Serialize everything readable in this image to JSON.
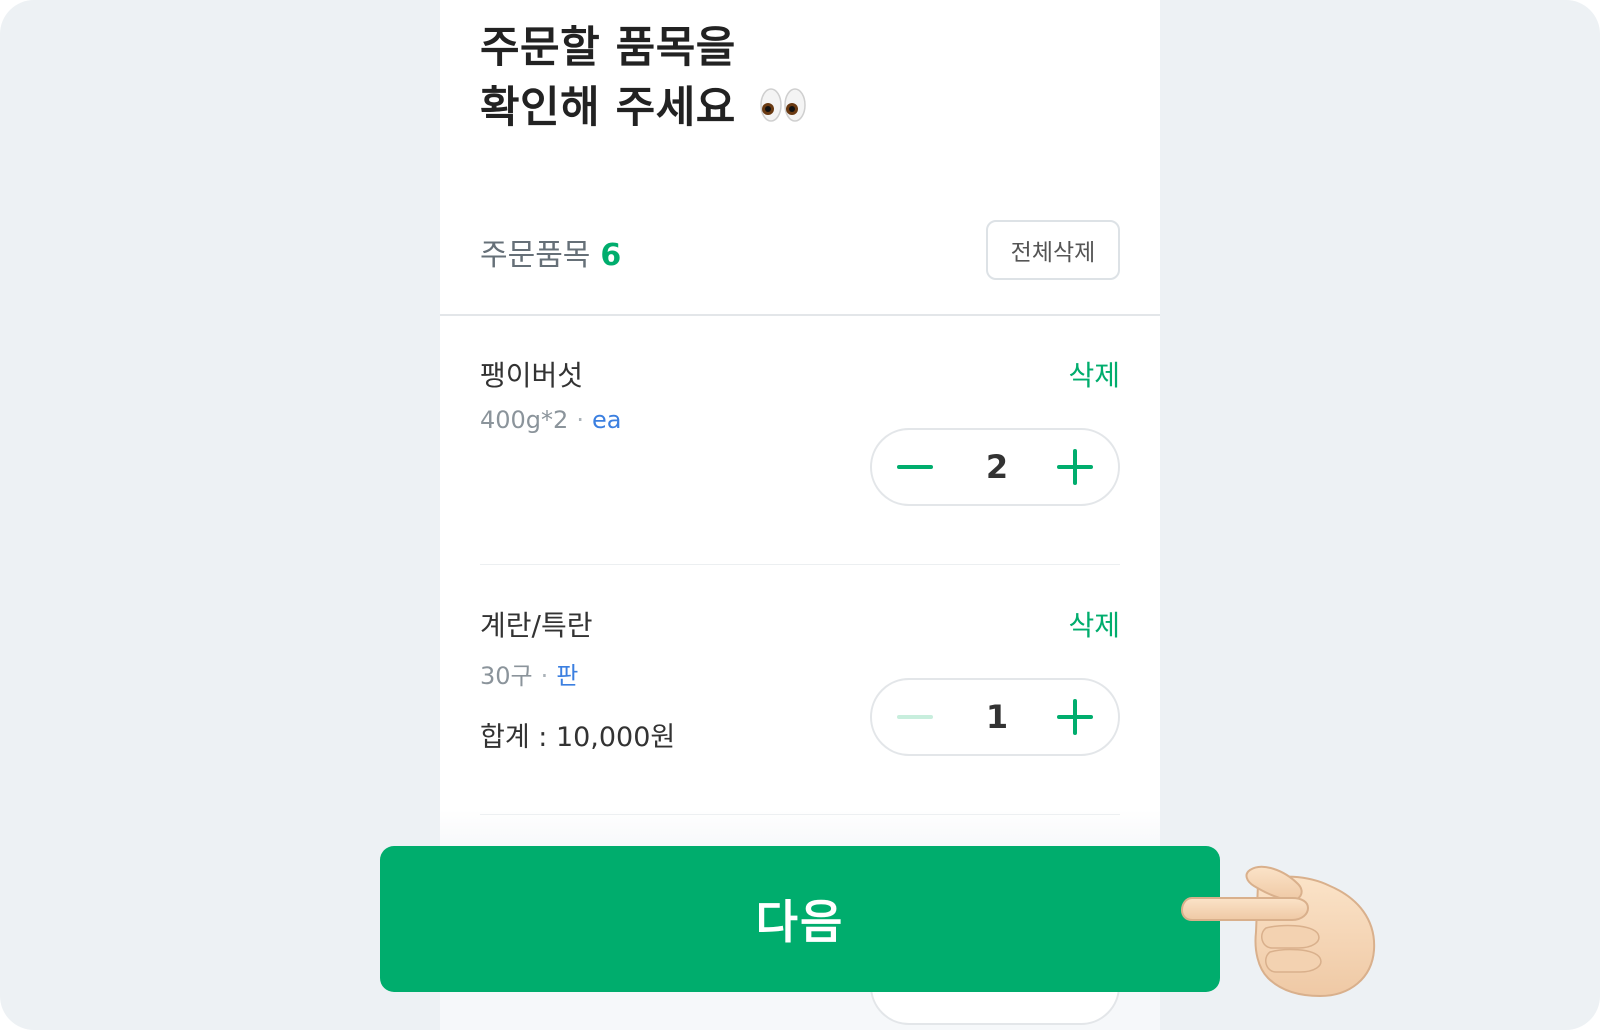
{
  "header": {
    "title_line1": "주문할 품목을",
    "title_line2": "확인해 주세요",
    "title_emoji": "eyes-emoji"
  },
  "summary": {
    "label": "주문품목",
    "count": "6",
    "clear_all_label": "전체삭제"
  },
  "items": [
    {
      "name": "팽이버섯",
      "spec": "400g*2",
      "unit": "ea",
      "delete_label": "삭제",
      "total": "",
      "quantity": "2",
      "minus_enabled": true
    },
    {
      "name": "계란/특란",
      "spec": "30구",
      "unit": "판",
      "delete_label": "삭제",
      "total": "합계 : 10,000원",
      "quantity": "1",
      "minus_enabled": false
    }
  ],
  "footer": {
    "next_label": "다음",
    "pointer_icon": "pointing-hand-emoji"
  },
  "colors": {
    "accent": "#00ad6d",
    "unit_blue": "#3b7fe0",
    "background": "#edf1f4"
  }
}
